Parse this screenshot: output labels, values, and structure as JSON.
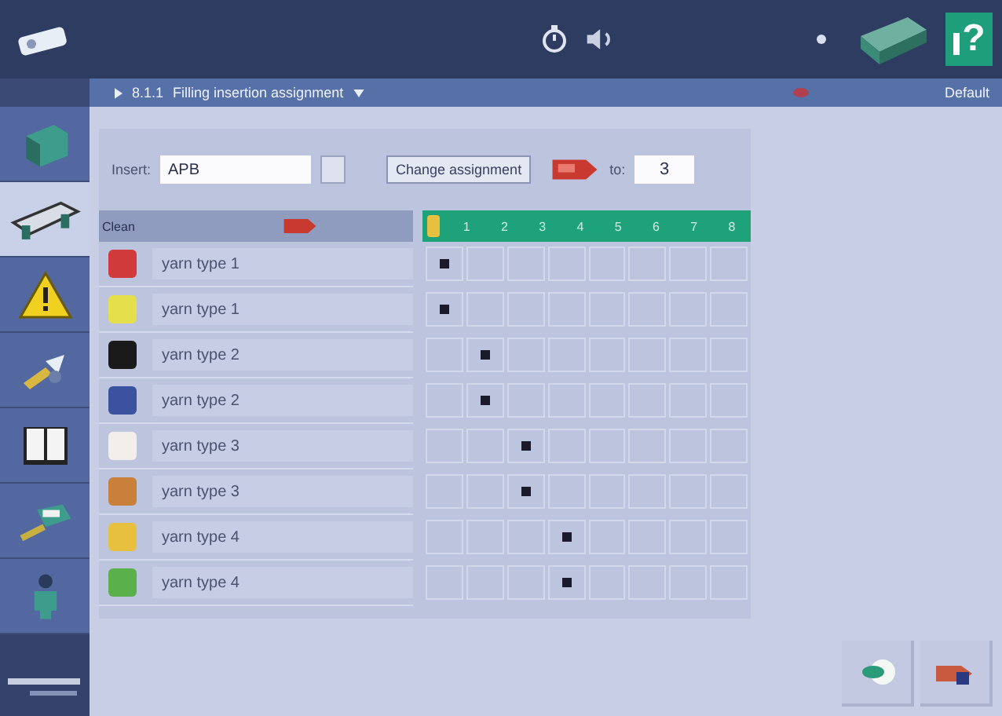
{
  "top_bar": {
    "help_glyph": "?"
  },
  "breadcrumb": {
    "code": "8.1.1",
    "title": "Filling insertion assignment",
    "right": "Default"
  },
  "sidebar": {
    "items": [
      {
        "kind": "machine",
        "selected": false
      },
      {
        "kind": "loom",
        "selected": true
      },
      {
        "kind": "warning",
        "selected": false
      },
      {
        "kind": "tools",
        "selected": false
      },
      {
        "kind": "book",
        "selected": false
      },
      {
        "kind": "maintenance",
        "selected": false
      },
      {
        "kind": "operator",
        "selected": false
      }
    ]
  },
  "controls": {
    "insert_label": "Insert:",
    "insert_value": "APB",
    "change_button": "Change assignment",
    "to_label": "to:",
    "to_value": "3"
  },
  "table": {
    "name_header": "Clean",
    "columns": [
      "1",
      "2",
      "3",
      "4",
      "5",
      "6",
      "7",
      "8"
    ],
    "rows": [
      {
        "color": "#d03a3a",
        "name": "yarn type 1",
        "cells": [
          {
            "checked": true
          },
          {
            "checked": false
          },
          {
            "checked": false
          },
          {
            "checked": false
          },
          {
            "checked": false
          },
          {
            "checked": false
          },
          {
            "checked": false
          },
          {
            "checked": false
          }
        ]
      },
      {
        "color": "#e4df4a",
        "name": "yarn type 1",
        "cells": [
          {
            "checked": true
          },
          {
            "checked": false
          },
          {
            "checked": false
          },
          {
            "checked": false
          },
          {
            "checked": false
          },
          {
            "checked": false
          },
          {
            "checked": false
          },
          {
            "checked": false
          }
        ]
      },
      {
        "color": "#1a1a1a",
        "name": "yarn type 2",
        "cells": [
          {
            "checked": false
          },
          {
            "checked": true
          },
          {
            "checked": false
          },
          {
            "checked": false
          },
          {
            "checked": false
          },
          {
            "checked": false
          },
          {
            "checked": false
          },
          {
            "checked": false
          }
        ]
      },
      {
        "color": "#3a52a0",
        "name": "yarn type 2",
        "cells": [
          {
            "checked": false
          },
          {
            "checked": true
          },
          {
            "checked": false
          },
          {
            "checked": false
          },
          {
            "checked": false
          },
          {
            "checked": false
          },
          {
            "checked": false
          },
          {
            "checked": false
          }
        ]
      },
      {
        "color": "#f2eeea",
        "name": "yarn type 3",
        "cells": [
          {
            "checked": false
          },
          {
            "checked": false
          },
          {
            "checked": true
          },
          {
            "checked": false
          },
          {
            "checked": false
          },
          {
            "checked": false
          },
          {
            "checked": false
          },
          {
            "checked": false
          }
        ]
      },
      {
        "color": "#c8803a",
        "name": "yarn type 3",
        "cells": [
          {
            "checked": false
          },
          {
            "checked": false
          },
          {
            "checked": true
          },
          {
            "checked": false
          },
          {
            "checked": false
          },
          {
            "checked": false
          },
          {
            "checked": false
          },
          {
            "checked": false
          }
        ]
      },
      {
        "color": "#e8c040",
        "name": "yarn type 4",
        "cells": [
          {
            "checked": false
          },
          {
            "checked": false
          },
          {
            "checked": false
          },
          {
            "checked": true
          },
          {
            "checked": false
          },
          {
            "checked": false
          },
          {
            "checked": false
          },
          {
            "checked": false
          }
        ]
      },
      {
        "color": "#5ab04a",
        "name": "yarn type 4",
        "cells": [
          {
            "checked": false
          },
          {
            "checked": false
          },
          {
            "checked": false
          },
          {
            "checked": true
          },
          {
            "checked": false
          },
          {
            "checked": false
          },
          {
            "checked": false
          },
          {
            "checked": false
          }
        ]
      }
    ]
  }
}
